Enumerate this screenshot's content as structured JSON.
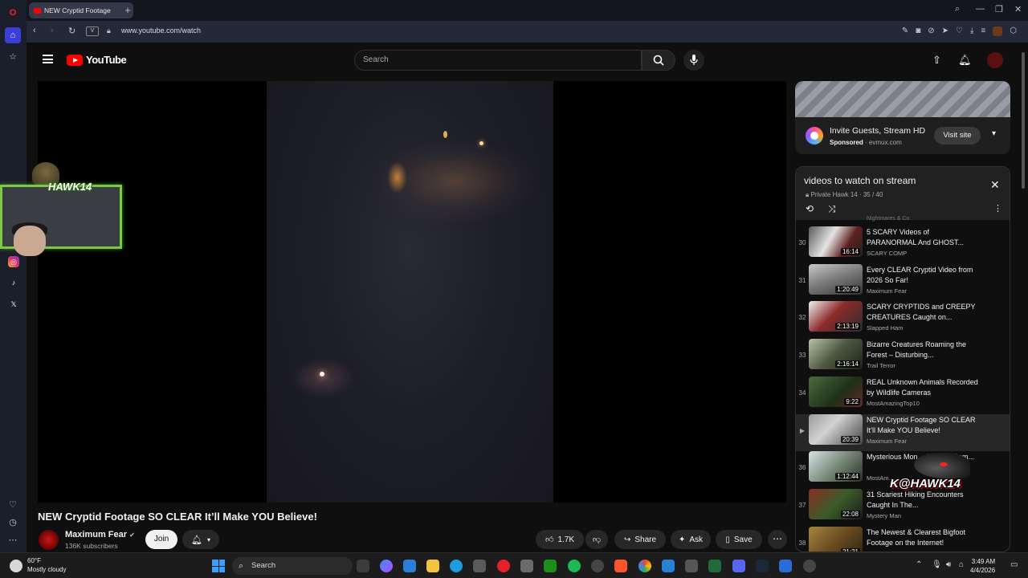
{
  "browser": {
    "tab_title": "NEW Cryptid Footage",
    "new_tab": "+",
    "url": "www.youtube.com/watch",
    "addr_badge": "V"
  },
  "youtube": {
    "logo_text": "YouTube",
    "search_placeholder": "Search"
  },
  "webcam": {
    "tag": "HAWK14"
  },
  "video": {
    "title": "NEW Cryptid Footage SO CLEAR It’ll Make YOU Believe!",
    "channel": "Maximum Fear",
    "subscribers": "136K subscribers",
    "join": "Join",
    "likes": "1.7K",
    "share": "Share",
    "ask": "Ask",
    "save": "Save"
  },
  "ad": {
    "title": "Invite Guests, Stream HD",
    "sponsored": "Sponsored",
    "domain": "evmux.com",
    "cta": "Visit site"
  },
  "playlist": {
    "title": "videos to watch on stream",
    "subtitle": "Private Hawk 14 · 35 / 40",
    "previous_channel": "Nightmares & Co.",
    "items": [
      {
        "num": "30",
        "title": "5 SCARY Videos of PARANORMAL And GHOST...",
        "channel": "SCARY COMP",
        "duration": "16:14"
      },
      {
        "num": "31",
        "title": "Every CLEAR Cryptid Video from 2026 So Far!",
        "channel": "Maximum Fear",
        "duration": "1:20:49"
      },
      {
        "num": "32",
        "title": "SCARY CRYPTIDS and CREEPY CREATURES Caught on...",
        "channel": "Slapped Ham",
        "duration": "2:13:19"
      },
      {
        "num": "33",
        "title": "Bizarre Creatures Roaming the Forest – Disturbing...",
        "channel": "Trail Terror",
        "duration": "2:16:14"
      },
      {
        "num": "34",
        "title": "REAL Unknown Animals Recorded by Wildlife Cameras",
        "channel": "MostAmazingTop10",
        "duration": "9:22"
      },
      {
        "num": "▶",
        "title": "NEW Cryptid Footage SO CLEAR It’ll Make YOU Believe!",
        "channel": "Maximum Fear",
        "duration": "20:39"
      },
      {
        "num": "36",
        "title": "Mysterious Mon... On Trail Cam...",
        "channel": "MostAm...",
        "duration": "1:12:44"
      },
      {
        "num": "37",
        "title": "31 Scariest Hiking Encounters Caught In The...",
        "channel": "Mystery Man",
        "duration": "22:08"
      },
      {
        "num": "38",
        "title": "The Newest & Clearest Bigfoot Footage on the Internet!",
        "channel": "",
        "duration": "21:21"
      }
    ]
  },
  "overlay": {
    "hawk_logo_text": "K@HAWK14"
  },
  "taskbar": {
    "temp": "60°F",
    "weather": "Mostly cloudy",
    "search": "Search",
    "time": "3:49 AM",
    "date": "4/4/2026"
  }
}
